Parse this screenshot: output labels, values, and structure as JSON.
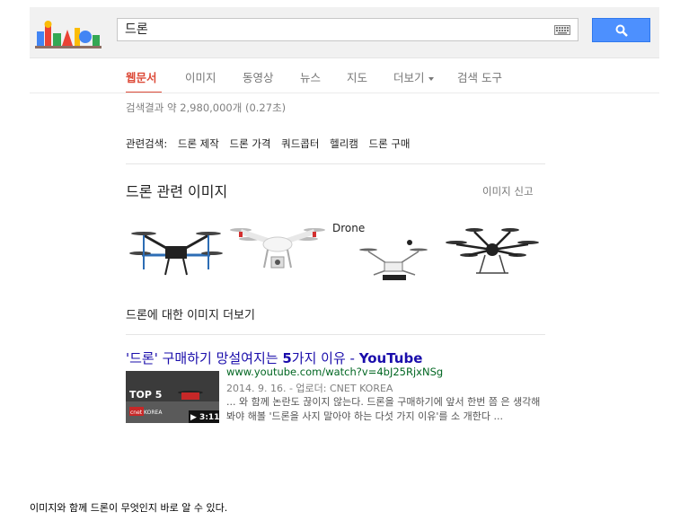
{
  "search": {
    "query": "드론"
  },
  "tabs": [
    {
      "label": "웹문서",
      "active": true
    },
    {
      "label": "이미지"
    },
    {
      "label": "동영상"
    },
    {
      "label": "뉴스"
    },
    {
      "label": "지도"
    },
    {
      "label": "더보기"
    },
    {
      "label": "검색 도구"
    }
  ],
  "stats": "검색결과 약 2,980,000개 (0.27초)",
  "related": {
    "label": "관련검색:",
    "items": [
      "드론 제작",
      "드론 가격",
      "쿼드콥터",
      "헬리캠",
      "드론 구매"
    ]
  },
  "images_section": {
    "title": "드론 관련 이미지",
    "report": "이미지 신고",
    "more": "드론에 대한 이미지 더보기",
    "thumb3_text": "Drone"
  },
  "result": {
    "title_prefix": "'드론' 구매하기 망설여지는 ",
    "title_bold": "5",
    "title_suffix": "가지 이유 - ",
    "title_site": "YouTube",
    "url": "www.youtube.com/watch?v=4bJ25RjxNSg",
    "meta": "2014. 9. 16. - 업로더: CNET KOREA",
    "snippet": "... 와 함께 논란도 끊이지 않는다. 드론을 구매하기에 앞서 한번 쯤 은 생각해봐야 해볼 '드론을 사지 말아야 하는 다섯 가지 이유'를 소 개한다 ...",
    "video": {
      "badge": "TOP 5",
      "channel": "cnet KOREA",
      "duration": "▶ 3:11"
    }
  },
  "caption": "이미지와 함께 드론이 무엇인지 바로 알 수 있다.",
  "colors": {
    "accent": "#dd4b39",
    "link": "#1a0dab",
    "url": "#006621",
    "button": "#4d90fe"
  }
}
